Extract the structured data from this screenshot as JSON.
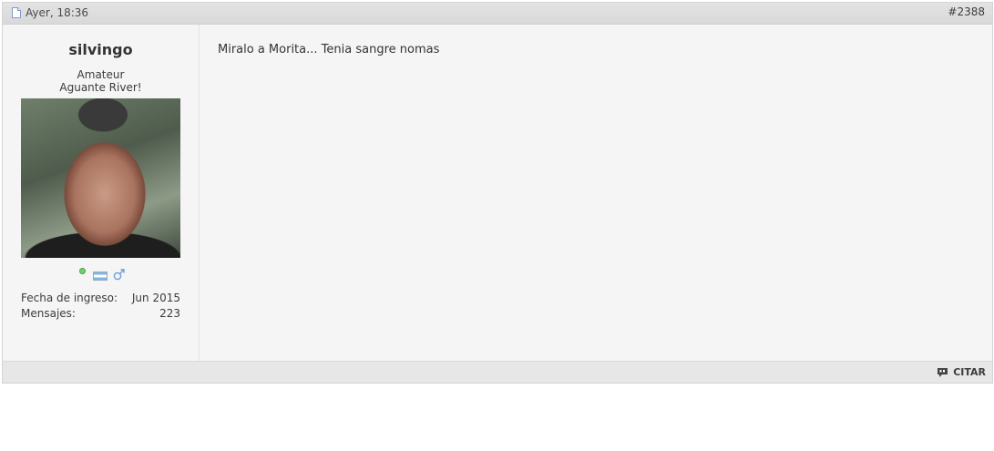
{
  "post": {
    "date": "Ayer, 18:36",
    "number": "#2388",
    "message": "Miralo a Morita... Tenia sangre nomas"
  },
  "user": {
    "name": "silvingo",
    "rank": "Amateur",
    "custom_title": "Aguante River!",
    "status": "online",
    "stats": [
      {
        "label": "Fecha de ingreso:",
        "value": "Jun 2015"
      },
      {
        "label": "Mensajes:",
        "value": "223"
      }
    ]
  },
  "footer": {
    "quote_label": "CITAR"
  },
  "colors": {
    "header_bg": "#d9d9d9",
    "post_bg": "#f5f5f5",
    "footer_bg": "#e7e7e7",
    "online": "#6fd06f"
  }
}
